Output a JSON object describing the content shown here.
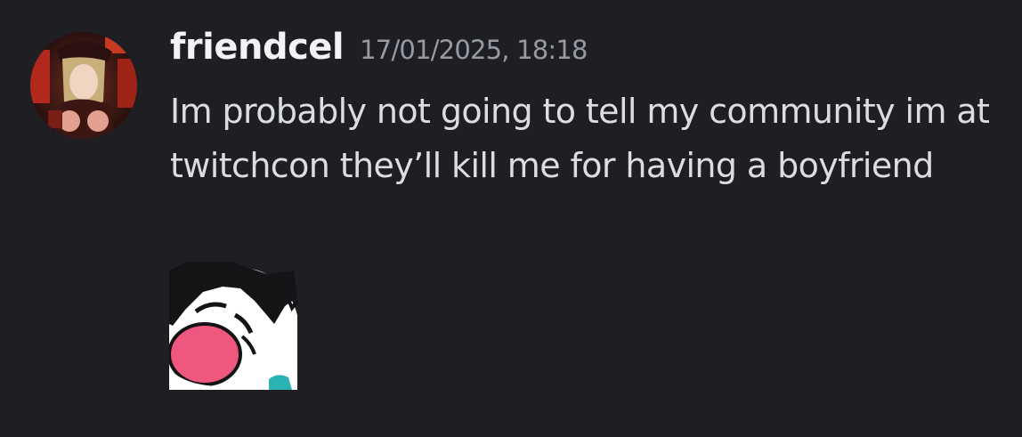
{
  "message": {
    "author": "friendcel",
    "timestamp": "17/01/2025, 18:18",
    "text": "Im probably not going to tell my community im at twitchcon they’ll kill me for having a boyfriend"
  },
  "avatar": {
    "icon": "user-avatar-image"
  },
  "attachment": {
    "icon": "sticker-image"
  },
  "colors": {
    "background": "#1f1f23",
    "username": "#f2f3f5",
    "timestamp": "#949ba4",
    "text": "#dbdee1"
  }
}
